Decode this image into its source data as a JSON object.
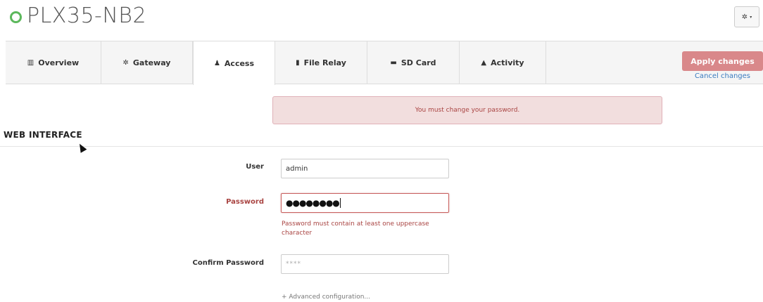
{
  "header": {
    "title": "PLX35-NB2",
    "status_color": "#5cb85c",
    "settings_icon": "gear-icon",
    "settings_caret": "▾"
  },
  "tabs": [
    {
      "icon": "chart-icon",
      "glyph": "📊",
      "label": "Overview"
    },
    {
      "icon": "gear-icon",
      "glyph": "✲",
      "label": "Gateway"
    },
    {
      "icon": "user-icon",
      "glyph": "👤",
      "label": "Access"
    },
    {
      "icon": "file-icon",
      "glyph": "▰",
      "label": "File Relay"
    },
    {
      "icon": "folder-icon",
      "glyph": "▬",
      "label": "SD Card"
    },
    {
      "icon": "bell-icon",
      "glyph": "🔔",
      "label": "Activity"
    }
  ],
  "active_tab": "Access",
  "actions": {
    "apply_label": "Apply changes",
    "cancel_label": "Cancel changes"
  },
  "alert": {
    "message": "You must change your password."
  },
  "section": {
    "title": "WEB INTERFACE"
  },
  "form": {
    "user_label": "User",
    "user_value": "admin",
    "password_label": "Password",
    "password_value": "●●●●●●●●",
    "password_error": "Password must contain at least one uppercase character",
    "confirm_label": "Confirm Password",
    "confirm_placeholder": "****",
    "advanced_link": "+ Advanced configuration..."
  },
  "colors": {
    "error": "#a94442",
    "apply_button": "#d9888a",
    "link": "#3a7bbf"
  }
}
